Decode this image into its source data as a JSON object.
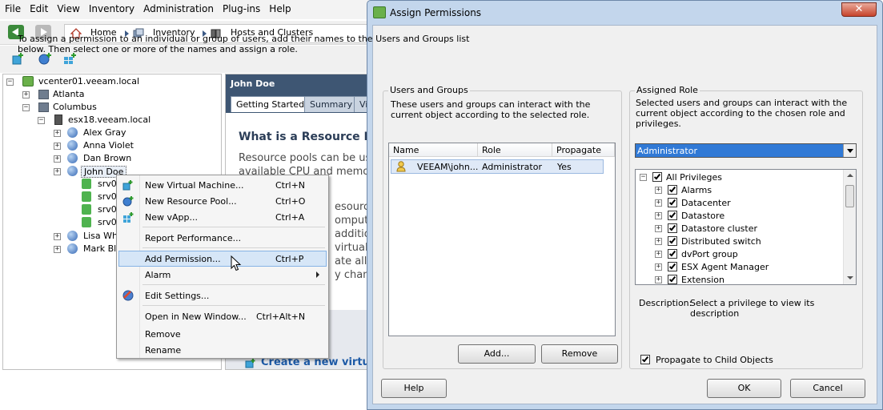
{
  "menubar": [
    "File",
    "Edit",
    "View",
    "Inventory",
    "Administration",
    "Plug-ins",
    "Help"
  ],
  "breadcrumb": {
    "home": "Home",
    "inventory": "Inventory",
    "hosts": "Hosts and Clusters"
  },
  "tree": {
    "vcenter": "vcenter01.veeam.local",
    "atlanta": "Atlanta",
    "columbus": "Columbus",
    "host": "esx18.veeam.local",
    "pools": [
      "Alex Gray",
      "Anna Violet",
      "Dan Brown",
      "John Doe"
    ],
    "vms": [
      "srv0",
      "srv0",
      "srv0",
      "srv0"
    ],
    "more_pools": [
      "Lisa Whit",
      "Mark Bla"
    ]
  },
  "right_panel": {
    "title": "John Doe",
    "tabs": [
      "Getting Started",
      "Summary",
      "Vi"
    ],
    "heading": "What is a Resource Poo",
    "text_lines": [
      "Resource pools can be us",
      "available CPU and memor",
      "",
      "esourc",
      "omputin",
      "additio",
      "virtual",
      "ate allo",
      "y chang"
    ],
    "link": "Create a new virtua"
  },
  "context_menu": {
    "items": [
      {
        "label": "New Virtual Machine...",
        "shortcut": "Ctrl+N"
      },
      {
        "label": "New Resource Pool...",
        "shortcut": "Ctrl+O"
      },
      {
        "label": "New vApp...",
        "shortcut": "Ctrl+A"
      },
      {
        "label": "Report Performance...",
        "shortcut": ""
      },
      {
        "label": "Add Permission...",
        "shortcut": "Ctrl+P"
      },
      {
        "label": "Alarm",
        "shortcut": ""
      },
      {
        "label": "Edit Settings...",
        "shortcut": ""
      },
      {
        "label": "Open in New Window...",
        "shortcut": "Ctrl+Alt+N"
      },
      {
        "label": "Remove",
        "shortcut": ""
      },
      {
        "label": "Rename",
        "shortcut": ""
      }
    ]
  },
  "dialog": {
    "title": "Assign Permissions",
    "close": "✕",
    "intro": "To assign a permission to an individual or group of users, add their names to the Users and Groups list below. Then select one or more of the names and assign a role.",
    "users_groups": {
      "title": "Users and Groups",
      "desc": "These users and groups can interact with the current object according to the selected role.",
      "columns": [
        "Name",
        "Role",
        "Propagate"
      ],
      "rows": [
        {
          "name": "VEEAM\\john...",
          "role": "Administrator",
          "propagate": "Yes"
        }
      ],
      "add_label": "Add...",
      "remove_label": "Remove"
    },
    "assigned_role": {
      "title": "Assigned Role",
      "desc": "Selected users and groups can interact with the current object according to the chosen role and privileges.",
      "selected_role": "Administrator",
      "privileges_root": "All Privileges",
      "privileges": [
        "Alarms",
        "Datacenter",
        "Datastore",
        "Datastore cluster",
        "Distributed switch",
        "dvPort group",
        "ESX Agent Manager",
        "Extension"
      ],
      "description_label": "Description:",
      "description_text": "Select a privilege to view its description",
      "propagate_label": "Propagate to Child Objects"
    },
    "help_label": "Help",
    "ok_label": "OK",
    "cancel_label": "Cancel"
  },
  "colors": {
    "selection_blue": "#3079d6",
    "header_navy": "#3e5673",
    "dialog_frame": "#c3d6ec"
  }
}
